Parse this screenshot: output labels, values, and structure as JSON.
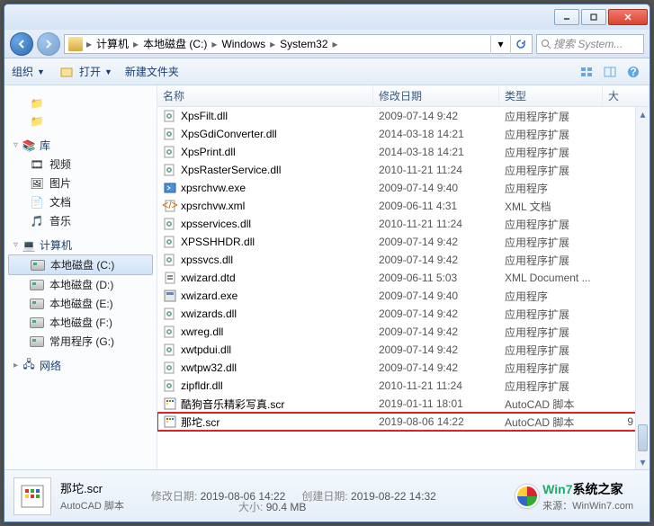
{
  "breadcrumb": [
    "计算机",
    "本地磁盘 (C:)",
    "Windows",
    "System32"
  ],
  "search_placeholder": "搜索 System...",
  "toolbar": {
    "organize": "组织",
    "open": "打开",
    "newfolder": "新建文件夹"
  },
  "columns": {
    "name": "名称",
    "date": "修改日期",
    "type": "类型",
    "size": "大"
  },
  "sidebar": {
    "libraries": {
      "label": "库",
      "items": [
        "视频",
        "图片",
        "文档",
        "音乐"
      ]
    },
    "computer": {
      "label": "计算机",
      "items": [
        "本地磁盘 (C:)",
        "本地磁盘 (D:)",
        "本地磁盘 (E:)",
        "本地磁盘 (F:)",
        "常用程序 (G:)"
      ]
    },
    "network": {
      "label": "网络"
    }
  },
  "files": [
    {
      "name": "XpsFilt.dll",
      "date": "2009-07-14 9:42",
      "type": "应用程序扩展",
      "icon": "dll"
    },
    {
      "name": "XpsGdiConverter.dll",
      "date": "2014-03-18 14:21",
      "type": "应用程序扩展",
      "icon": "dll"
    },
    {
      "name": "XpsPrint.dll",
      "date": "2014-03-18 14:21",
      "type": "应用程序扩展",
      "icon": "dll"
    },
    {
      "name": "XpsRasterService.dll",
      "date": "2010-11-21 11:24",
      "type": "应用程序扩展",
      "icon": "dll"
    },
    {
      "name": "xpsrchvw.exe",
      "date": "2009-07-14 9:40",
      "type": "应用程序",
      "icon": "exe"
    },
    {
      "name": "xpsrchvw.xml",
      "date": "2009-06-11 4:31",
      "type": "XML 文档",
      "icon": "xml"
    },
    {
      "name": "xpsservices.dll",
      "date": "2010-11-21 11:24",
      "type": "应用程序扩展",
      "icon": "dll"
    },
    {
      "name": "XPSSHHDR.dll",
      "date": "2009-07-14 9:42",
      "type": "应用程序扩展",
      "icon": "dll"
    },
    {
      "name": "xpssvcs.dll",
      "date": "2009-07-14 9:42",
      "type": "应用程序扩展",
      "icon": "dll"
    },
    {
      "name": "xwizard.dtd",
      "date": "2009-06-11 5:03",
      "type": "XML Document ...",
      "icon": "dtd"
    },
    {
      "name": "xwizard.exe",
      "date": "2009-07-14 9:40",
      "type": "应用程序",
      "icon": "exe2"
    },
    {
      "name": "xwizards.dll",
      "date": "2009-07-14 9:42",
      "type": "应用程序扩展",
      "icon": "dll"
    },
    {
      "name": "xwreg.dll",
      "date": "2009-07-14 9:42",
      "type": "应用程序扩展",
      "icon": "dll"
    },
    {
      "name": "xwtpdui.dll",
      "date": "2009-07-14 9:42",
      "type": "应用程序扩展",
      "icon": "dll"
    },
    {
      "name": "xwtpw32.dll",
      "date": "2009-07-14 9:42",
      "type": "应用程序扩展",
      "icon": "dll"
    },
    {
      "name": "zipfldr.dll",
      "date": "2010-11-21 11:24",
      "type": "应用程序扩展",
      "icon": "dll"
    },
    {
      "name": "酷狗音乐精彩写真.scr",
      "date": "2019-01-11 18:01",
      "type": "AutoCAD 脚本",
      "icon": "scr"
    },
    {
      "name": "那坨.scr",
      "date": "2019-08-06 14:22",
      "type": "AutoCAD 脚本",
      "icon": "scr",
      "size": "9",
      "highlight": true
    }
  ],
  "details": {
    "title": "那坨.scr",
    "subtitle": "AutoCAD 脚本",
    "mod_label": "修改日期:",
    "mod_value": "2019-08-06 14:22",
    "create_label": "创建日期:",
    "create_value": "2019-08-22 14:32",
    "size_label": "大小:",
    "size_value": "90.4 MB"
  },
  "watermark": {
    "brand": "Win7",
    "suffix": "系统之家",
    "url": "来源：WinWin7.com"
  }
}
